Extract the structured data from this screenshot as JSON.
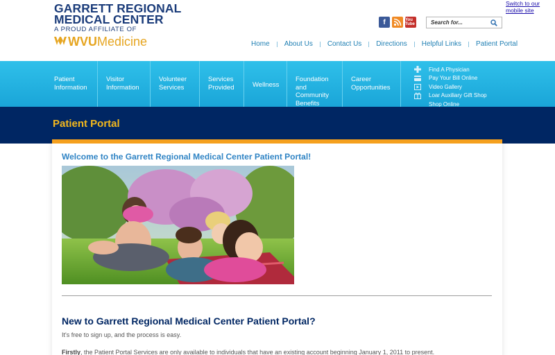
{
  "header": {
    "logo": {
      "line1": "GARRETT REGIONAL",
      "line2": "MEDICAL CENTER",
      "affiliate": "A PROUD AFFILIATE OF",
      "brand_bold": "WVU",
      "brand_rest": "Medicine"
    },
    "mobile_link": "Switch to our mobile site",
    "social": [
      {
        "icon": "facebook-icon",
        "text": "f"
      },
      {
        "icon": "rss-icon",
        "text": ""
      },
      {
        "icon": "youtube-icon",
        "text": "You Tube"
      }
    ],
    "search_placeholder": "Search for...",
    "top_nav": [
      "Home",
      "About Us",
      "Contact Us",
      "Directions",
      "Helpful Links",
      "Patient Portal"
    ]
  },
  "main_nav": {
    "items": [
      {
        "line1": "Patient",
        "line2": "Information",
        "line3": "",
        "line4": ""
      },
      {
        "line1": "Visitor",
        "line2": "Information",
        "line3": "",
        "line4": ""
      },
      {
        "line1": "Volunteer",
        "line2": "Services",
        "line3": "",
        "line4": ""
      },
      {
        "line1": "Services",
        "line2": "Provided",
        "line3": "",
        "line4": ""
      },
      {
        "line1": "Wellness",
        "line2": "",
        "line3": "",
        "line4": ""
      },
      {
        "line1": "Foundation",
        "line2": "and",
        "line3": "Community",
        "line4": "Benefits"
      },
      {
        "line1": "Career",
        "line2": "Opportunities",
        "line3": "",
        "line4": ""
      }
    ],
    "quick_links": [
      {
        "label": "Find A Physician",
        "icon": "plus-icon"
      },
      {
        "label": "Pay Your Bill Online",
        "icon": "card-icon"
      },
      {
        "label": "Video Gallery",
        "icon": "video-icon"
      },
      {
        "label": "Loar Auxiliary Gift Shop",
        "icon": "gift-icon"
      },
      {
        "label": "Shop Online",
        "icon": ""
      }
    ]
  },
  "page": {
    "title": "Patient Portal",
    "welcome": "Welcome to the Garrett Regional Medical Center Patient Portal!",
    "new_heading": "New to Garrett Regional Medical Center Patient Portal?",
    "free_text": "It's free to sign up, and the process is easy.",
    "firstly_bold": "Firstly",
    "firstly_text": ", the Patient Portal Services are only available to individuals that have an existing account beginning January 1, 2011 to present."
  },
  "colors": {
    "navy": "#002663",
    "sky": "#1aa5d8",
    "gold": "#f3b81d",
    "orange": "#f5a01e",
    "link_blue": "#1f7fb3"
  }
}
